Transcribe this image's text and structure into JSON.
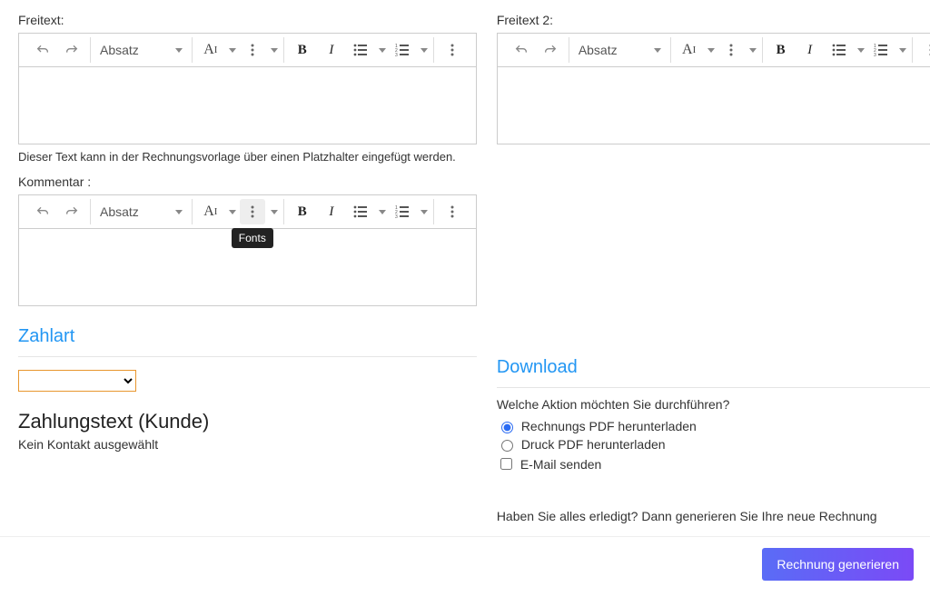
{
  "freitext": {
    "label": "Freitext:",
    "format": "Absatz",
    "help": "Dieser Text kann in der Rechnungsvorlage über einen Platzhalter eingefügt werden."
  },
  "freitext2": {
    "label": "Freitext 2:",
    "format": "Absatz"
  },
  "kommentar": {
    "label": "Kommentar :",
    "format": "Absatz",
    "tooltip": "Fonts"
  },
  "zahlart": {
    "heading": "Zahlart",
    "sub_heading": "Zahlungstext (Kunde)",
    "no_contact": "Kein Kontakt ausgewählt"
  },
  "download": {
    "heading": "Download",
    "question": "Welche Aktion möchten Sie durchführen?",
    "opt_rechnungs_pdf": "Rechnungs PDF herunterladen",
    "opt_druck_pdf": "Druck PDF herunterladen",
    "opt_email": "E-Mail senden",
    "done_text": "Haben Sie alles erledigt? Dann generieren Sie Ihre neue Rechnung"
  },
  "footer": {
    "generate": "Rechnung generieren"
  }
}
